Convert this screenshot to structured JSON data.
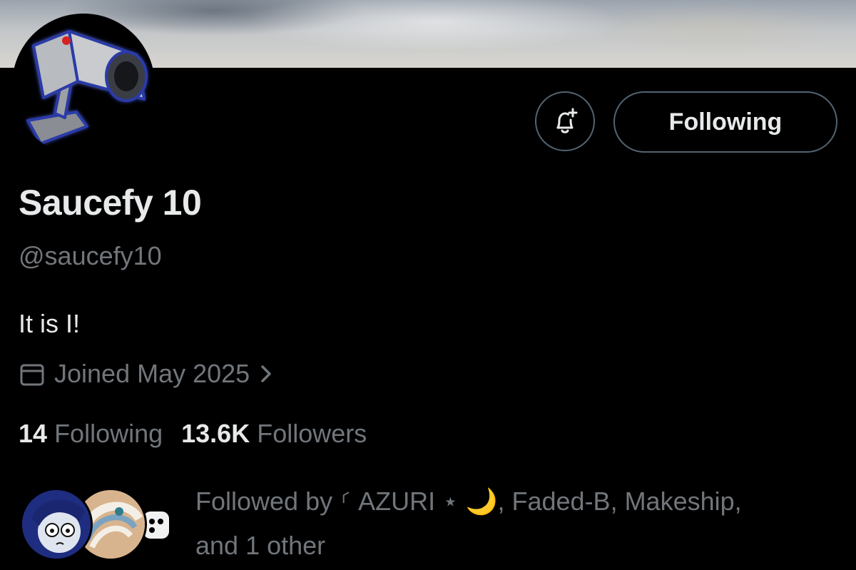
{
  "profile": {
    "display_name": "Saucefy 10",
    "handle": "@saucefy10",
    "bio": "It is I!",
    "joined": "Joined May 2025",
    "following_count": "14",
    "following_label": "Following",
    "followers_count": "13.6K",
    "followers_label": "Followers"
  },
  "actions": {
    "follow_state_label": "Following",
    "notify_icon": "bell-plus-icon"
  },
  "followed_by": {
    "prefix": "Followed by ",
    "names": "⸂ AZURI ⋆ 🌙, Faded-B, Makeship,",
    "suffix": "and 1 other"
  },
  "colors": {
    "background": "#000000",
    "primary_text": "#e7e9ea",
    "secondary_text": "#71767b",
    "border": "#536471"
  }
}
